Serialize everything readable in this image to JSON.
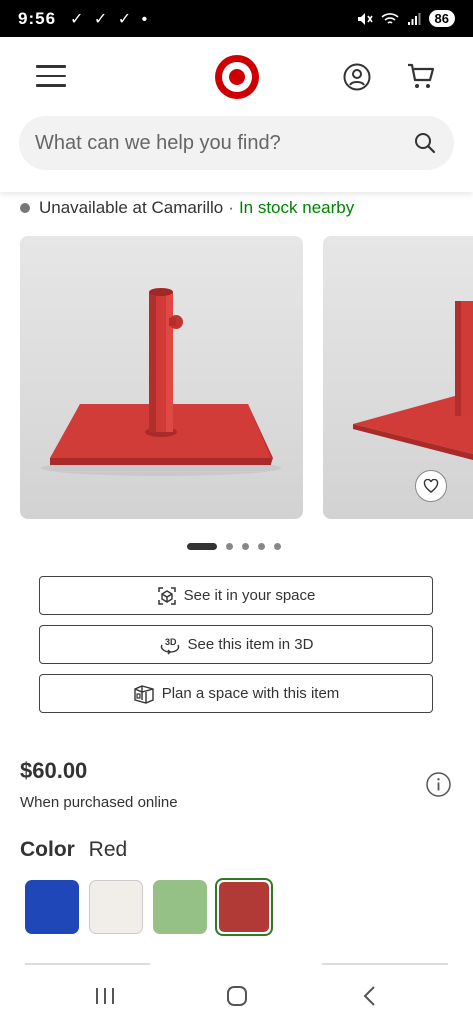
{
  "status_bar": {
    "time": "9:56",
    "checks": "✓ ✓ ✓ •",
    "battery": "86"
  },
  "search": {
    "placeholder": "What can we help you find?"
  },
  "availability": {
    "status": "Unavailable at Camarillo",
    "separator": "·",
    "nearby": "In stock nearby"
  },
  "carousel": {
    "total_slides": 5,
    "active_index": 0
  },
  "actions": [
    {
      "label": "See it in your space",
      "icon": "ar-cube-icon"
    },
    {
      "label": "See this item in 3D",
      "icon": "3d-rotate-icon"
    },
    {
      "label": "Plan a space with this item",
      "icon": "room-plan-icon"
    }
  ],
  "pricing": {
    "price": "$60.00",
    "note": "When purchased online"
  },
  "color": {
    "label": "Color",
    "selected": "Red",
    "swatches": [
      {
        "name": "blue",
        "hex": "#1f47b8"
      },
      {
        "name": "white",
        "hex": "#f1eeea"
      },
      {
        "name": "green",
        "hex": "#96c186"
      },
      {
        "name": "red",
        "hex": "#b23a36",
        "selected": true
      }
    ]
  },
  "colors": {
    "brand": "#cc0000",
    "in_stock": "#008300",
    "selected_border": "#2f7a22"
  }
}
